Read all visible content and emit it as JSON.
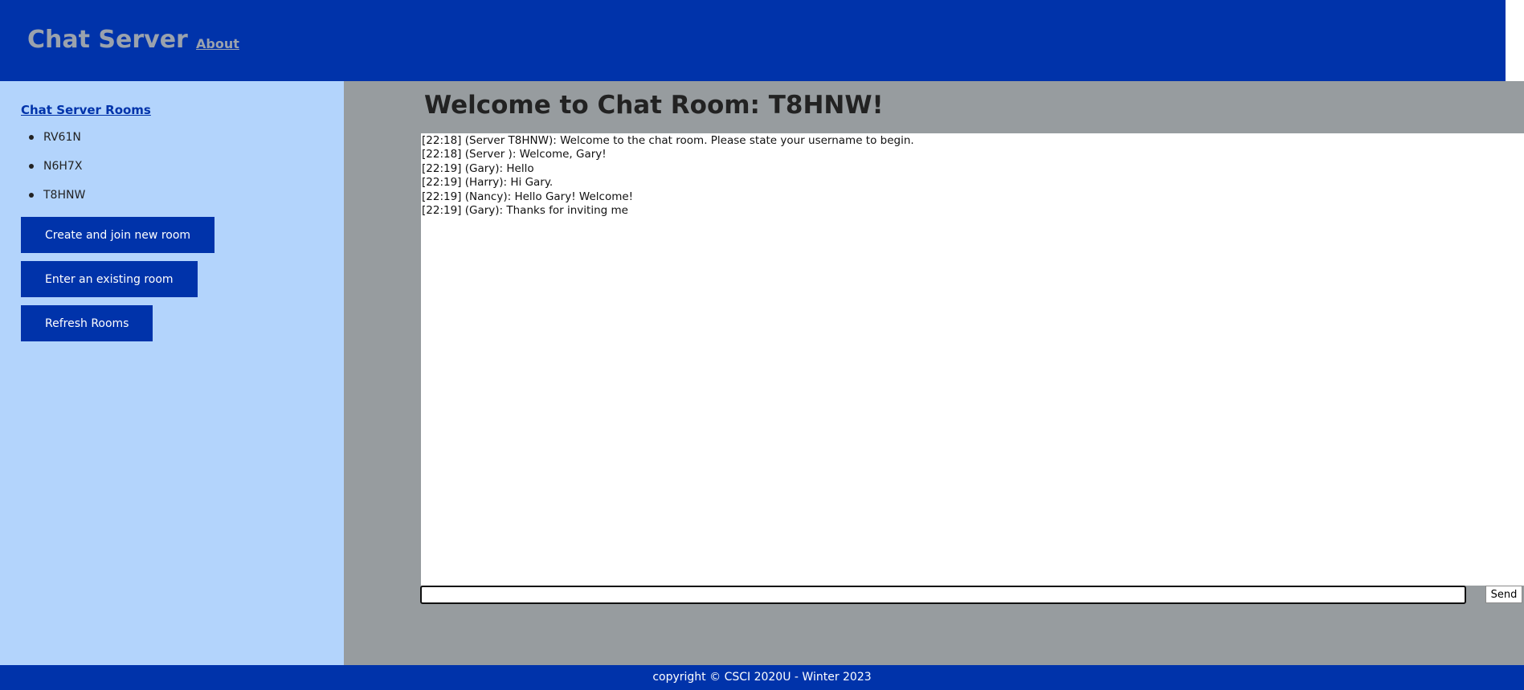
{
  "header": {
    "title": "Chat Server",
    "nav_about": "About"
  },
  "sidebar": {
    "heading": "Chat Server Rooms",
    "rooms": [
      "RV61N",
      "N6H7X",
      "T8HNW"
    ],
    "buttons": {
      "create": "Create and join new room",
      "enter": "Enter an existing room",
      "refresh": "Refresh Rooms"
    }
  },
  "main": {
    "title": "Welcome to Chat Room: T8HNW!",
    "messages": [
      "[22:18] (Server T8HNW): Welcome to the chat room. Please state your username to begin.",
      "[22:18] (Server ): Welcome, Gary!",
      "[22:19] (Gary): Hello",
      "[22:19] (Harry): Hi Gary.",
      "[22:19] (Nancy): Hello Gary! Welcome!",
      "[22:19] (Gary): Thanks for inviting me"
    ],
    "input_value": "",
    "send_label": "Send"
  },
  "footer": {
    "text": "copyright © CSCI 2020U - Winter 2023"
  },
  "colors": {
    "primary": "#0033aa",
    "sidebar_bg": "#b3d4fc",
    "main_bg": "#979c9f",
    "header_text": "#9aa2ad"
  }
}
